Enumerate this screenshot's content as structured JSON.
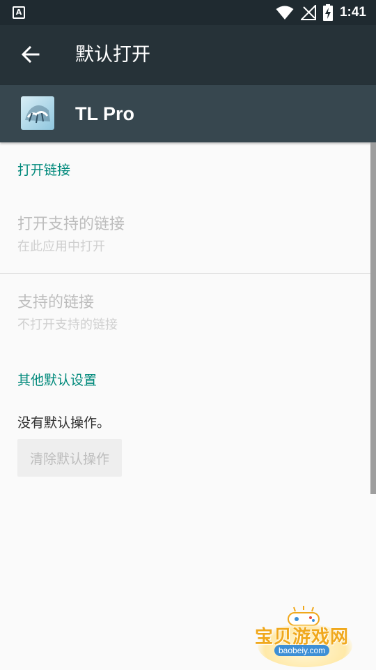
{
  "status_bar": {
    "time": "1:41",
    "notification_letter": "A"
  },
  "app_bar": {
    "title": "默认打开"
  },
  "app_header": {
    "name": "TL Pro"
  },
  "sections": {
    "open_links": {
      "title": "打开链接",
      "open_supported": {
        "title": "打开支持的链接",
        "summary": "在此应用中打开"
      },
      "supported_links": {
        "title": "支持的链接",
        "summary": "不打开支持的链接"
      }
    },
    "other_defaults": {
      "title": "其他默认设置",
      "message": "没有默认操作。",
      "clear_button": "清除默认操作"
    }
  },
  "watermark": {
    "text": "宝贝游戏网",
    "url": "baobeiy.com"
  },
  "colors": {
    "accent": "#00897b",
    "app_bar": "#263238",
    "header": "#37474f"
  }
}
